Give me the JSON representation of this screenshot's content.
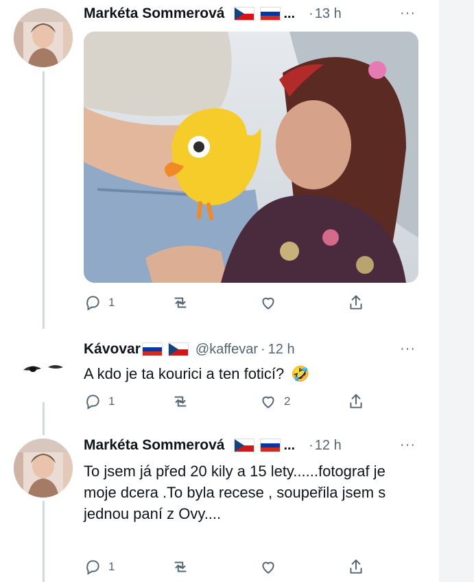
{
  "thread": [
    {
      "author": "Markéta Sommerová",
      "flags": [
        "cz",
        "ru"
      ],
      "ellipsis": "...",
      "time": "13 h",
      "more": "···",
      "has_media": true,
      "media_alt": "photo",
      "actions": {
        "reply": "1",
        "retweet": "",
        "like": "",
        "share": ""
      }
    },
    {
      "author": "Kávovar",
      "flags": [
        "ru",
        "cz"
      ],
      "handle": "@kaffevar",
      "time": "12 h",
      "more": "···",
      "text": "A kdo je ta kourici a ten foticí?",
      "emoji": "🤣",
      "actions": {
        "reply": "1",
        "retweet": "",
        "like": "2",
        "share": ""
      }
    },
    {
      "author": "Markéta Sommerová",
      "flags": [
        "cz",
        "ru"
      ],
      "ellipsis": "...",
      "time": "12 h",
      "more": "···",
      "text": "To jsem já před 20 kily a 15 lety......fotograf je moje dcera .To byla recese , soupeřila jsem s jednou paní z Ovy....",
      "actions": {
        "reply": "1",
        "retweet": "",
        "like": "",
        "share": ""
      }
    }
  ],
  "dot": "·",
  "colors": {
    "text": "#0f1419",
    "muted": "#536471",
    "line": "#cfd9de",
    "gutter": "#f3f4f5"
  }
}
